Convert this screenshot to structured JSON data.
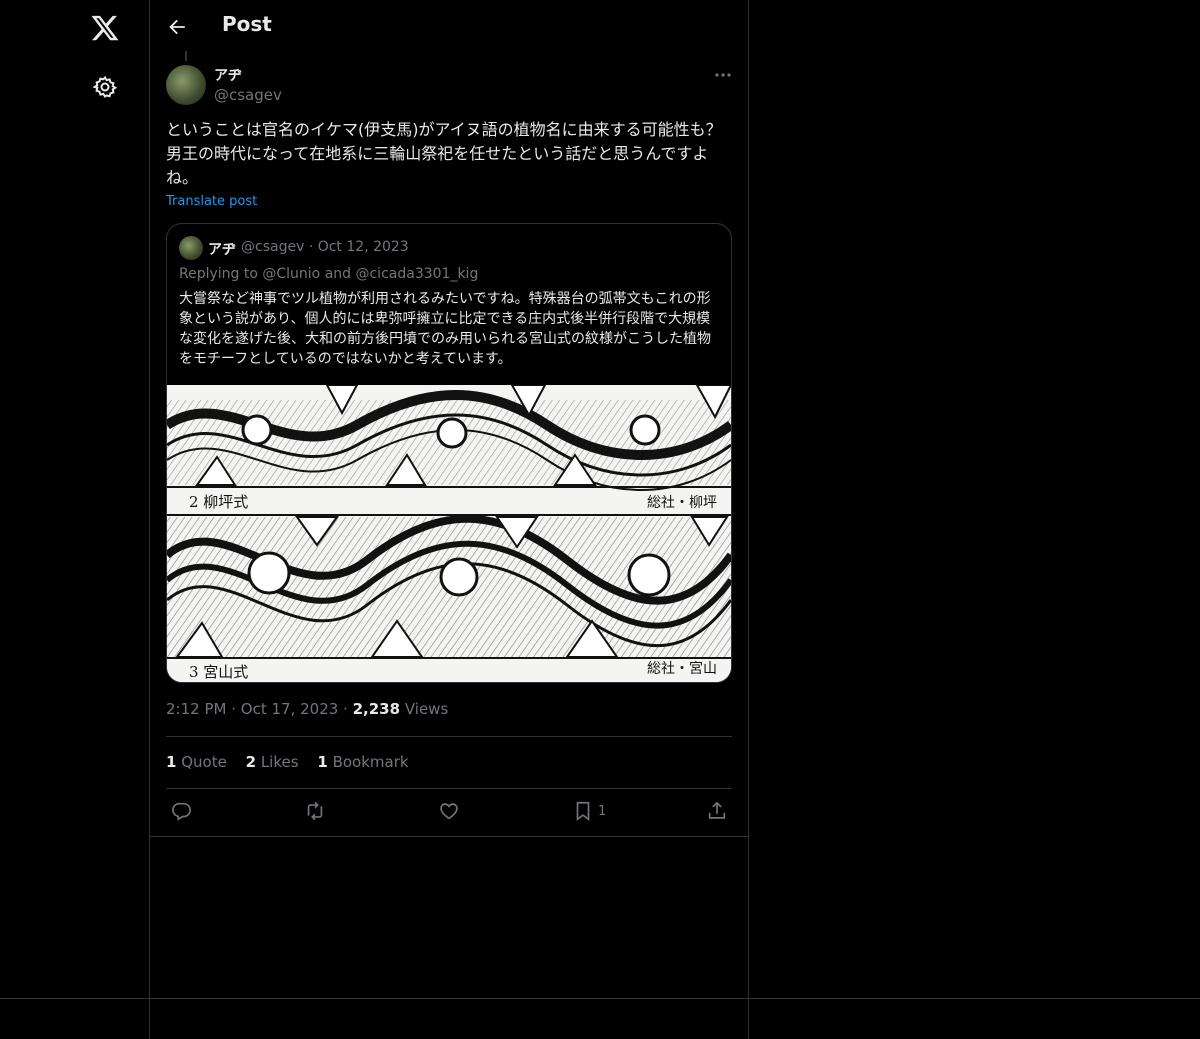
{
  "header": {
    "title": "Post",
    "back_label": "Back"
  },
  "post": {
    "display_name": "アヂ",
    "handle": "@csagev",
    "text": "ということは官名のイケマ(伊支馬)がアイヌ語の植物名に由来する可能性も？男王の時代になって在地系に三輪山祭祀を任せたという話だと思うんですよね。",
    "translate_label": "Translate post",
    "time": "2:12 PM",
    "date": "Oct 17, 2023",
    "views_count": "2,238",
    "views_label": "Views",
    "quote_count": "1",
    "quote_label": "Quote",
    "likes_count": "2",
    "likes_label": "Likes",
    "bookmark_count": "1",
    "bookmark_label": "Bookmark",
    "action_bookmark_count": "1"
  },
  "quoted": {
    "display_name": "アヂ",
    "handle": "@csagev",
    "date": "Oct 12, 2023",
    "replying": "Replying to @Clunio and @cicada3301_kig",
    "text": "大嘗祭など神事でツル植物が利用されるみたいですね。特殊器台の弧帯文もこれの形象という説があり、個人的には卑弥呼擁立に比定できる庄内式後半併行段階で大規模な変化を遂げた後、大和の前方後円墳でのみ用いられる宮山式の紋様がこうした植物をモチーフとしているのではないかと考えています。",
    "image": {
      "label_top_left": "2 柳坪式",
      "label_top_right": "総社・柳坪",
      "label_bottom_left": "3 宮山式",
      "label_bottom_right": "総社・宮山"
    }
  },
  "icons": {
    "logo": "x-logo-icon",
    "settings": "gear-icon",
    "back": "arrow-left-icon",
    "more": "more-dots-icon",
    "reply": "reply-icon",
    "repost": "repost-icon",
    "like": "heart-icon",
    "bookmark": "bookmark-icon",
    "share": "share-icon"
  }
}
